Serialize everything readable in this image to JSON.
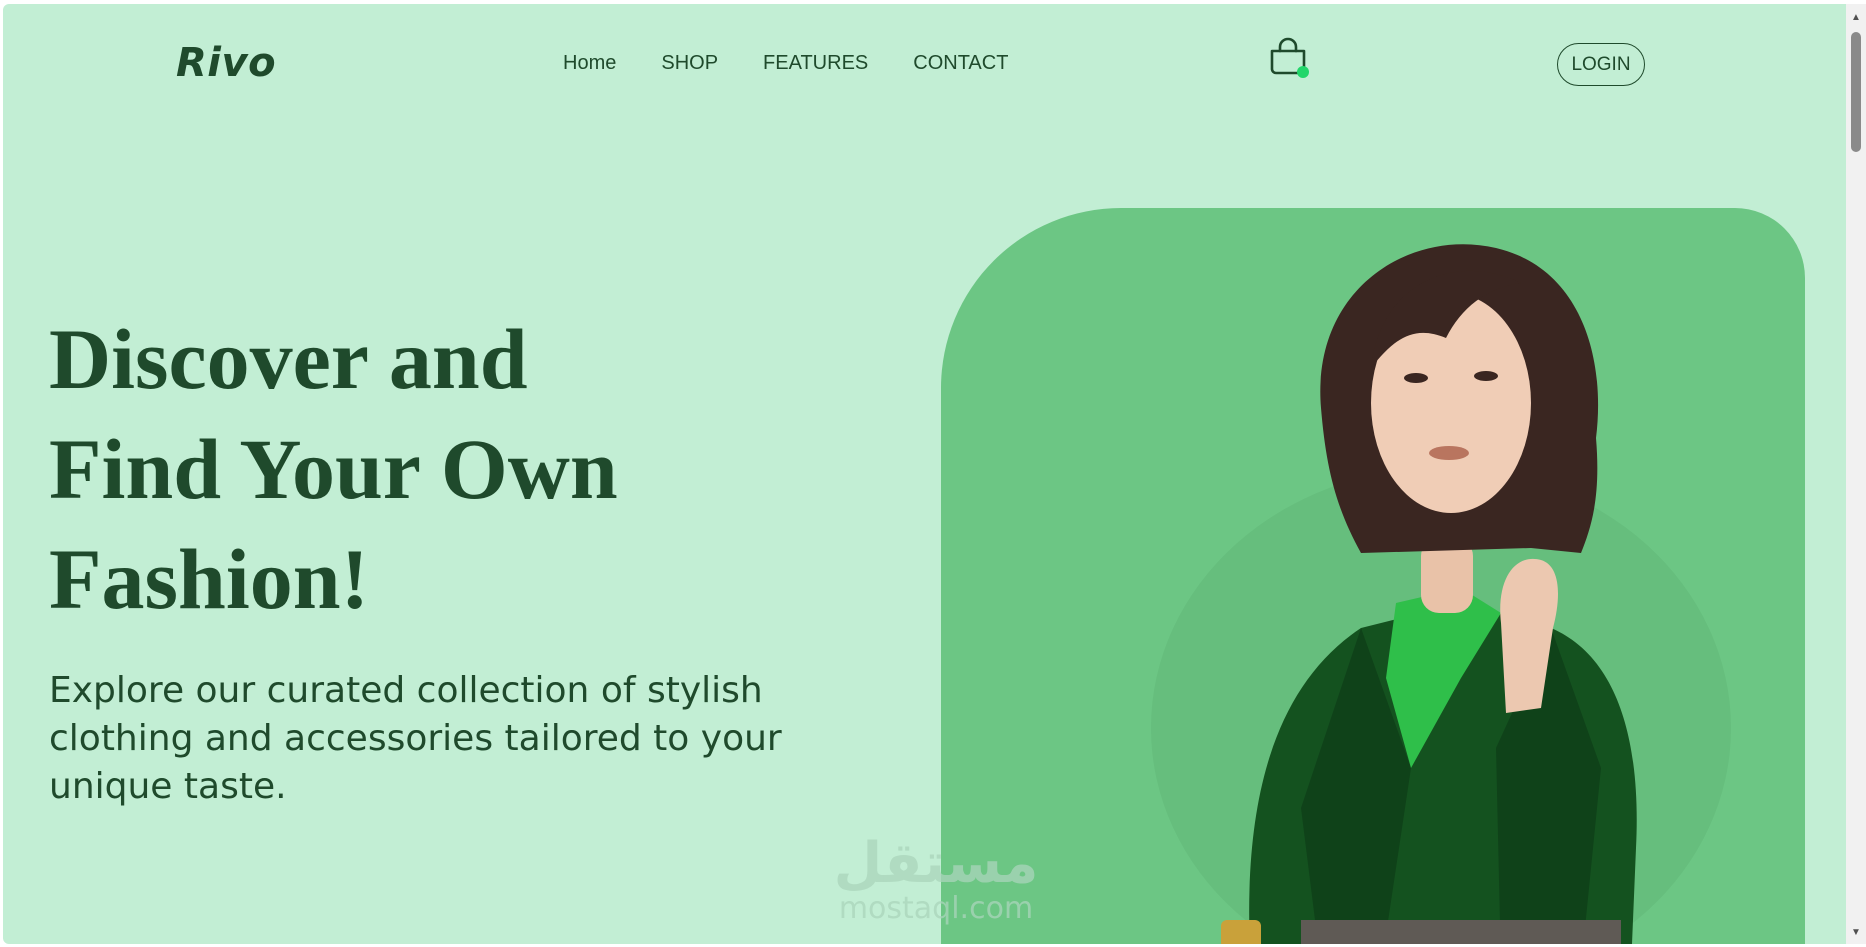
{
  "header": {
    "logo": "Rivo",
    "nav": [
      {
        "label": "Home"
      },
      {
        "label": "SHOP"
      },
      {
        "label": "FEATURES"
      },
      {
        "label": "CONTACT"
      }
    ],
    "cart_icon": "shopping-bag-icon",
    "login_label": "LOGIN"
  },
  "hero": {
    "title_lines": [
      "Discover and",
      "Find Your Own",
      "Fashion!"
    ],
    "subtitle": "Explore our curated collection of stylish clothing and accessories tailored to your unique taste.",
    "image": "woman-in-green-blazer-photo"
  },
  "watermark": {
    "arabic": "مستقل",
    "latin": "mostaql.com"
  },
  "colors": {
    "background": "#c2eed4",
    "text": "#1f4a2c",
    "panel": "#6cc684",
    "cart_badge": "#22d66a"
  }
}
